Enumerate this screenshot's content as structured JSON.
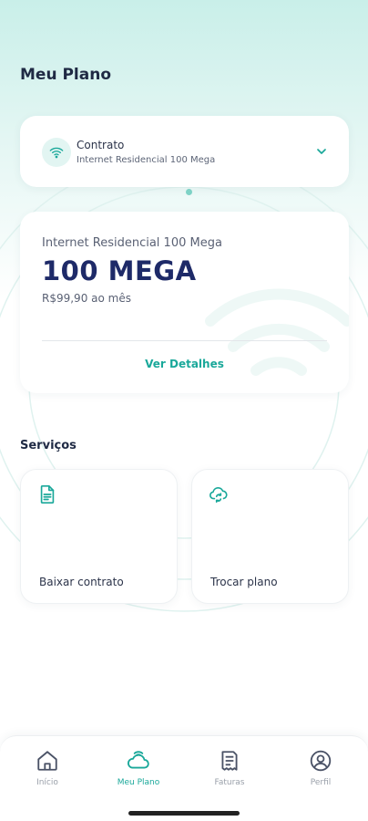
{
  "header": {
    "title": "Meu Plano"
  },
  "contract": {
    "label": "Contrato",
    "value": "Internet Residencial 100 Mega",
    "icon": "wifi-icon",
    "chevron": "chevron-down-icon"
  },
  "plan": {
    "name": "Internet Residencial 100 Mega",
    "speed": "100 MEGA",
    "price": "R$99,90 ao mês",
    "details_label": "Ver Detalhes"
  },
  "services": {
    "title": "Serviços",
    "items": [
      {
        "label": "Baixar contrato",
        "icon": "document-icon"
      },
      {
        "label": "Trocar plano",
        "icon": "cloud-sync-icon"
      }
    ]
  },
  "nav": {
    "items": [
      {
        "label": "Início",
        "icon": "home-icon",
        "active": false
      },
      {
        "label": "Meu Plano",
        "icon": "plan-icon",
        "active": true
      },
      {
        "label": "Faturas",
        "icon": "invoice-icon",
        "active": false
      },
      {
        "label": "Perfil",
        "icon": "profile-icon",
        "active": false
      }
    ]
  },
  "colors": {
    "accent": "#1aa89a",
    "primary_text": "#1e2a68",
    "background_top": "#c9efe9"
  }
}
